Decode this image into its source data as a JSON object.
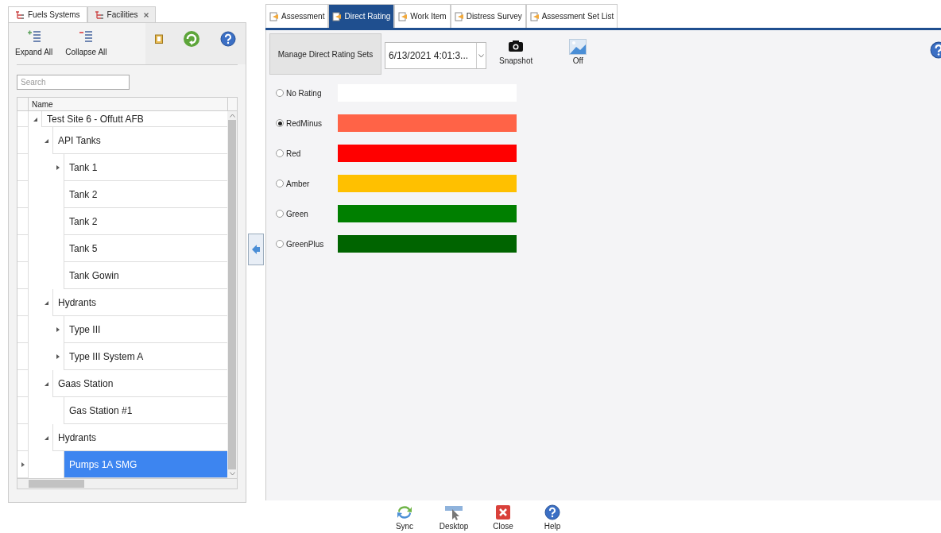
{
  "left_tabs": [
    {
      "label": "Fuels Systems",
      "selected": true,
      "closable": false
    },
    {
      "label": "Facilities",
      "selected": false,
      "closable": true
    }
  ],
  "toolbar": {
    "expand_all": "Expand All",
    "collapse_all": "Collapse All"
  },
  "search": {
    "placeholder": "Search"
  },
  "tree": {
    "column": "Name",
    "nodes": [
      {
        "label": "Test Site 6 - Offutt AFB",
        "expanded": true,
        "selected": false,
        "children": [
          {
            "label": "API Tanks",
            "expanded": true,
            "selected": false,
            "children": [
              {
                "label": "Tank 1",
                "expanded": false,
                "selected": false
              },
              {
                "label": "Tank 2",
                "selected": false
              },
              {
                "label": "Tank 2",
                "selected": false
              },
              {
                "label": "Tank 5",
                "selected": false
              },
              {
                "label": "Tank Gowin",
                "selected": false
              }
            ]
          },
          {
            "label": "Hydrants",
            "expanded": true,
            "selected": false,
            "children": [
              {
                "label": "Type III",
                "expanded": false,
                "selected": false
              },
              {
                "label": "Type III System A",
                "expanded": false,
                "selected": false
              }
            ]
          },
          {
            "label": "Gaas Station",
            "expanded": true,
            "selected": false,
            "children": [
              {
                "label": "Gas Station #1",
                "selected": false
              }
            ]
          },
          {
            "label": "Hydrants",
            "expanded": true,
            "selected": false,
            "children": [
              {
                "label": "Pumps 1A SMG",
                "selected": true
              }
            ]
          }
        ]
      }
    ]
  },
  "right_tabs": [
    {
      "label": "Assessment",
      "selected": false
    },
    {
      "label": "Direct Rating",
      "selected": true
    },
    {
      "label": "Work Item",
      "selected": false
    },
    {
      "label": "Distress Survey",
      "selected": false
    },
    {
      "label": "Assessment Set List",
      "selected": false
    }
  ],
  "manage_button": "Manage Direct Rating Sets",
  "rating_set": {
    "value": "6/13/2021 4:01:3..."
  },
  "snapshot": "Snapshot",
  "image_toggle": "Off",
  "ratings": [
    {
      "label": "No Rating",
      "selected": false,
      "color": "#ffffff"
    },
    {
      "label": "RedMinus",
      "selected": true,
      "color": "#ff6347"
    },
    {
      "label": "Red",
      "selected": false,
      "color": "#ff0000"
    },
    {
      "label": "Amber",
      "selected": false,
      "color": "#ffc000"
    },
    {
      "label": "Green",
      "selected": false,
      "color": "#007f00"
    },
    {
      "label": "GreenPlus",
      "selected": false,
      "color": "#006400"
    }
  ],
  "bottom_buttons": [
    {
      "kind": "sync",
      "label": "Sync"
    },
    {
      "kind": "desktop",
      "label": "Desktop"
    },
    {
      "kind": "close",
      "label": "Close"
    },
    {
      "kind": "help",
      "label": "Help"
    }
  ]
}
